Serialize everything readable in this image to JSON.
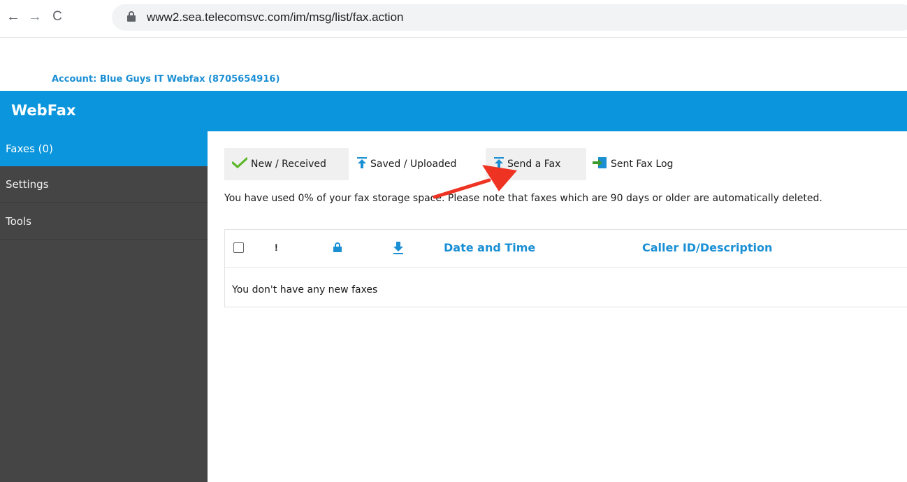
{
  "browser": {
    "back_icon": "←",
    "forward_icon": "→",
    "reload_icon": "C",
    "url": "www2.sea.telecomsvc.com/im/msg/list/fax.action"
  },
  "account": {
    "label": "Account: Blue Guys IT Webfax (8705654916)"
  },
  "header": {
    "title": "WebFax",
    "color": "#0a95dc"
  },
  "sidebar": {
    "items": [
      {
        "label": "Faxes (0)",
        "active": true
      },
      {
        "label": "Settings",
        "active": false
      },
      {
        "label": "Tools",
        "active": false
      }
    ]
  },
  "tabs": [
    {
      "label": "New / Received",
      "icon": "check-icon"
    },
    {
      "label": "Saved / Uploaded",
      "icon": "upload-icon"
    },
    {
      "label": "Send a Fax",
      "icon": "upload-icon"
    },
    {
      "label": "Sent Fax Log",
      "icon": "sent-log-icon"
    }
  ],
  "storage_notice": "You have used 0% of your fax storage space. Please note that faxes which are 90 days or older are automatically deleted.",
  "table": {
    "columns": {
      "flag": "!",
      "date": "Date and Time",
      "caller": "Caller ID/Description"
    },
    "empty_message": "You don't have any new faxes"
  },
  "colors": {
    "accent": "#0a95dc",
    "link": "#1a8fd4",
    "sidebar_bg": "#454545",
    "annotation": "#ee3322"
  }
}
